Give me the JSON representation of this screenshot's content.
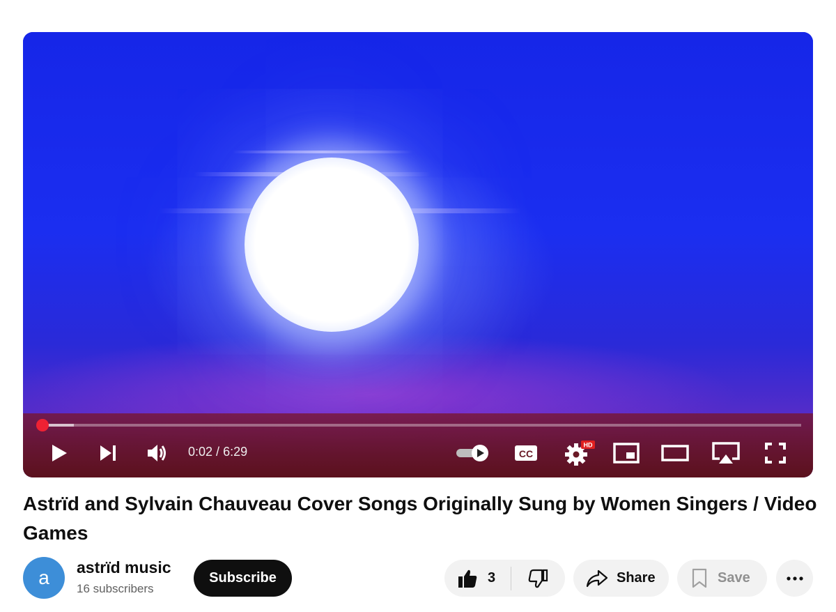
{
  "player": {
    "current_time": "0:02",
    "separator": " / ",
    "duration": "6:29",
    "played_fraction": 0.005,
    "buffered_fraction": 0.046,
    "autoplay_on": true,
    "hd_badge": "HD",
    "cc_label": "CC",
    "progress_color": "#ff0000"
  },
  "video": {
    "title": "Astrïd and Sylvain Chauveau Cover Songs Originally Sung by Women Singers / Video Games"
  },
  "channel": {
    "avatar_letter": "a",
    "avatar_color": "#3d8ed8",
    "name": "astrïd music",
    "subscribers": "16 subscribers"
  },
  "actions": {
    "subscribe_label": "Subscribe",
    "like_count": "3",
    "share_label": "Share",
    "save_label": "Save"
  }
}
